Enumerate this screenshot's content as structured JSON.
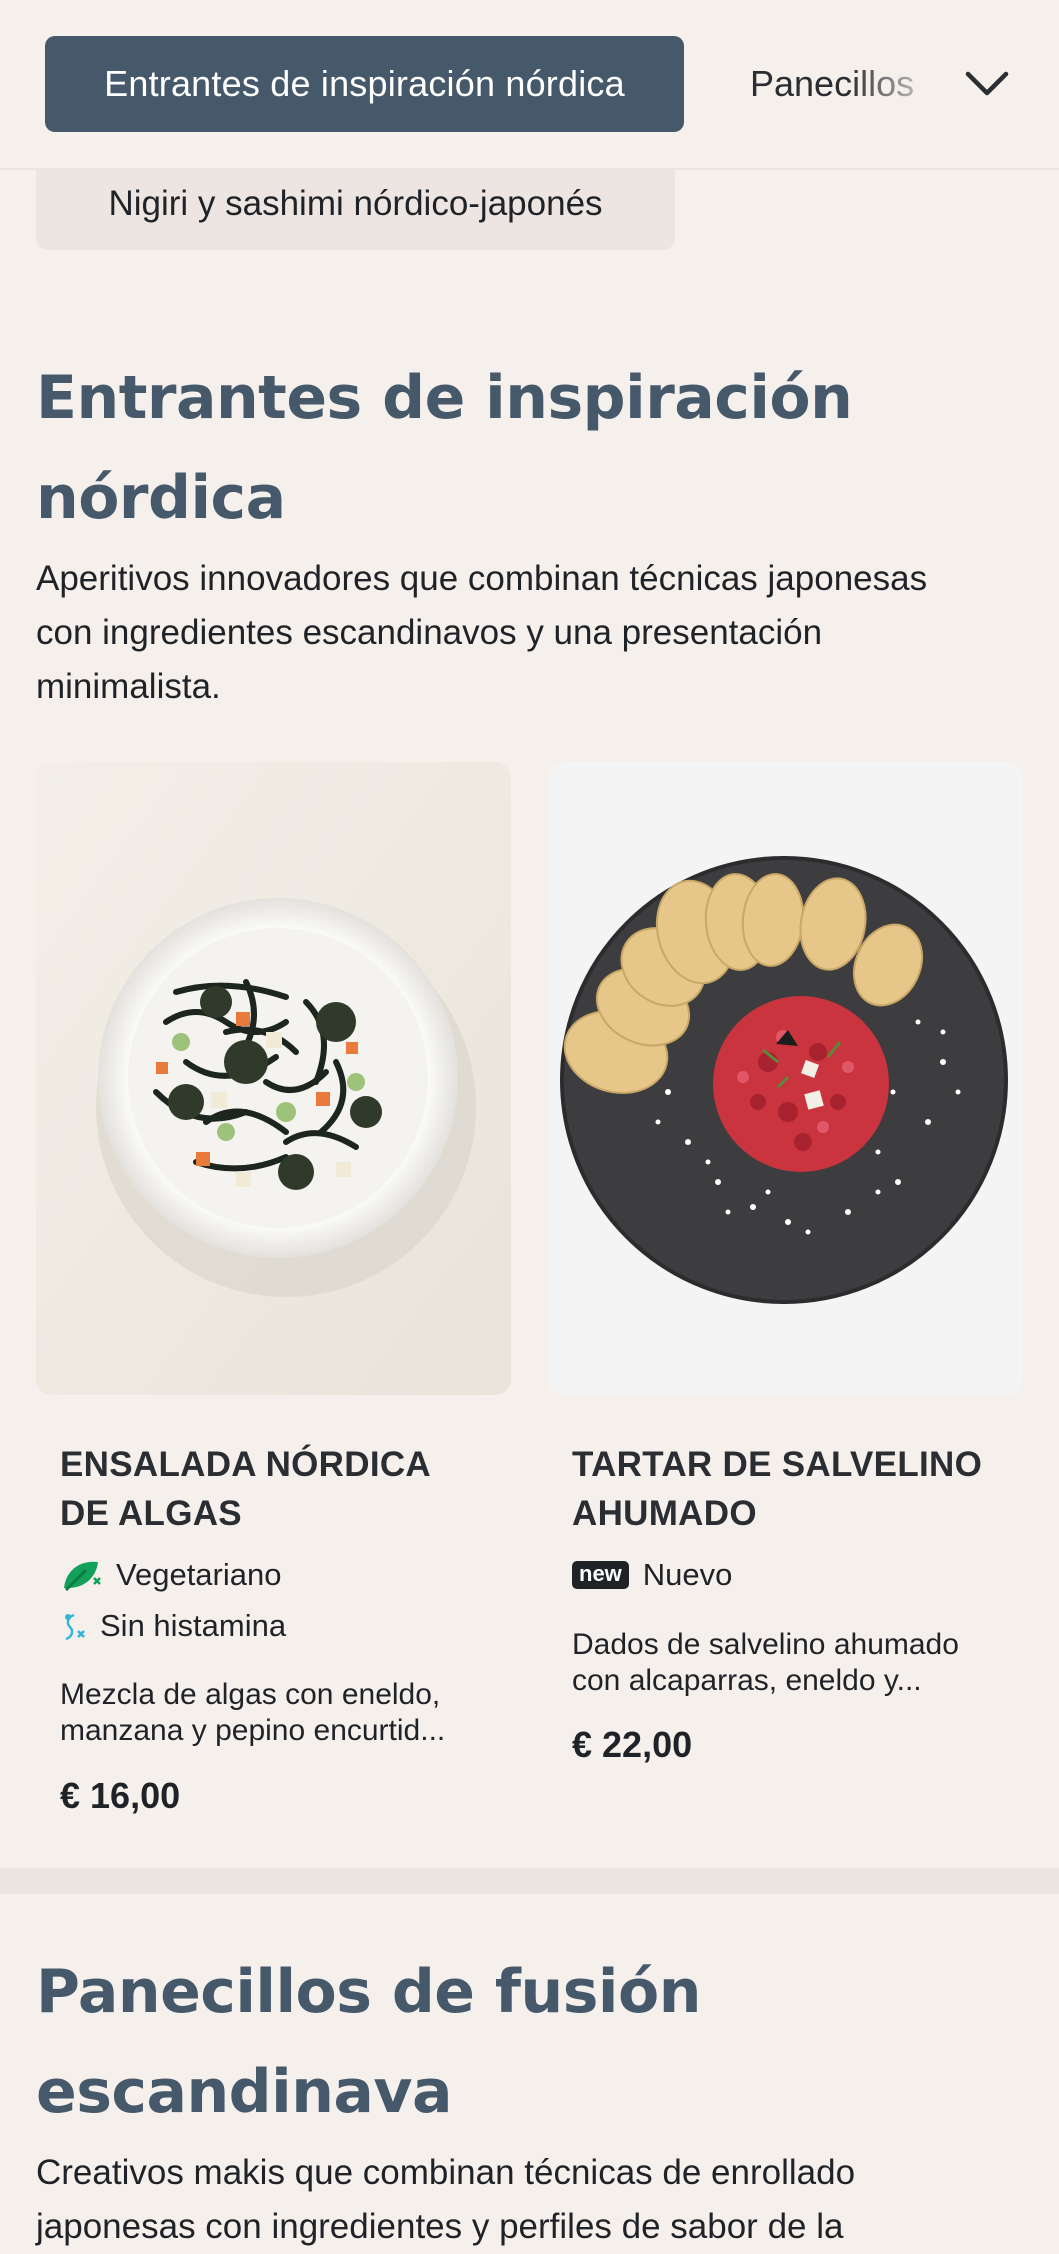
{
  "category_nav": {
    "active_label": "Entrantes de inspiración nórdica",
    "next_label": "Panecillos",
    "overflow_chip_label": "Nigiri y sashimi nórdico-japonés",
    "dropdown_icon": "chevron-down-icon"
  },
  "sections": [
    {
      "title_line1": "Entrantes de inspiración",
      "title_line2": "nórdica",
      "description_line1": "Aperitivos innovadores que combinan técnicas japonesas",
      "description_line2": "con ingredientes escandinavos y una presentación",
      "description_line3": "minimalista.",
      "products": [
        {
          "name_line1": "ENSALADA NÓRDICA",
          "name_line2": "DE ALGAS",
          "tags": [
            {
              "icon": "vegetarian-leaf-icon",
              "label": "Vegetariano"
            },
            {
              "icon": "histamine-free-icon",
              "label": "Sin histamina"
            }
          ],
          "description_line1": "Mezcla de algas con eneldo,",
          "description_line2": "manzana y pepino encurtid...",
          "price": "€ 16,00",
          "image": "seaweed-salad-bowl"
        },
        {
          "name_line1": "TARTAR DE SALVELINO",
          "name_line2": "AHUMADO",
          "tags": [
            {
              "icon": "new-badge",
              "badge_text": "new",
              "label": "Nuevo"
            }
          ],
          "description_line1": "Dados de salvelino ahumado",
          "description_line2": "con alcaparras, eneldo y...",
          "price": "€ 22,00",
          "image": "char-tartare-with-crackers"
        }
      ]
    },
    {
      "title_line1": "Panecillos de fusión",
      "title_line2": "escandinava",
      "description_line1": "Creativos makis que combinan técnicas de enrollado",
      "description_line2": "japonesas con ingredientes y perfiles de sabor de la"
    }
  ],
  "colors": {
    "background": "#f6f0ed",
    "accent": "#45596a",
    "chip": "#ede5e1",
    "vegetarian_green": "#12a05a",
    "histamine_cyan": "#33b6d6"
  }
}
